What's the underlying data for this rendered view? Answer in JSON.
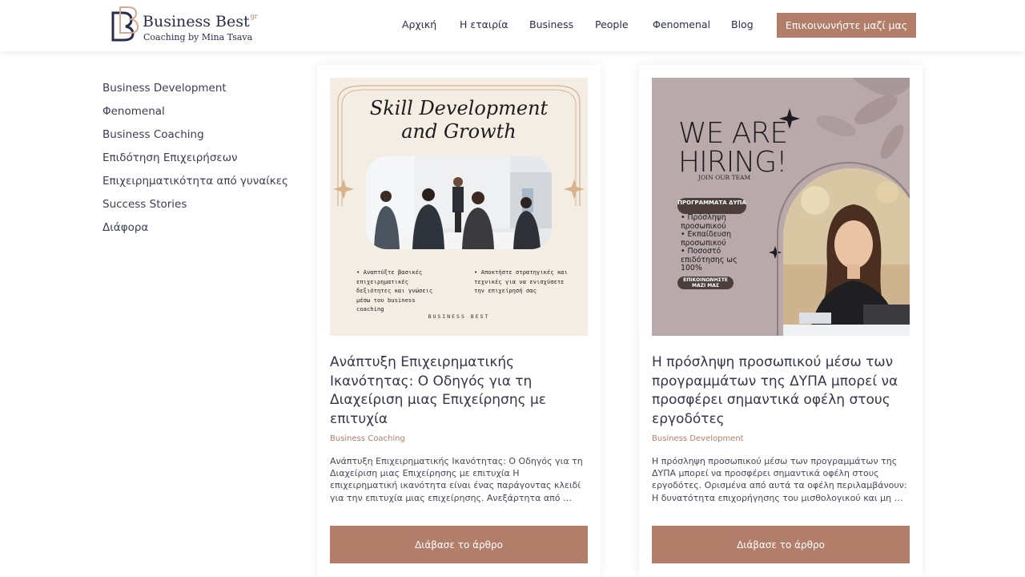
{
  "brand": {
    "name": "Business Best",
    "superscript": "gr",
    "tagline": "Coaching by Mina Tsava"
  },
  "nav": {
    "items": [
      {
        "label": "Αρχική"
      },
      {
        "label": "Η εταιρία"
      },
      {
        "label": "Business"
      },
      {
        "label": "People"
      },
      {
        "label": "Φenomenal"
      },
      {
        "label": "Blog"
      }
    ],
    "cta": "Επικοινωνήστε μαζί μας"
  },
  "sidebar": {
    "items": [
      {
        "label": "Business Development"
      },
      {
        "label": "Φenomenal"
      },
      {
        "label": "Business Coaching"
      },
      {
        "label": "Επιδότηση Επιχειρήσεων"
      },
      {
        "label": "Επιχειρηματικότητα από γυναίκες"
      },
      {
        "label": "Success Stories"
      },
      {
        "label": "Διάφορα"
      }
    ]
  },
  "posts": [
    {
      "title": "Ανάπτυξη Επιχειρηματικής Ικανότητας: Ο Οδηγός για τη Διαχείριση μιας Επιχείρησης με επιτυχία",
      "category": "Business Coaching",
      "excerpt": "Ανάπτυξη Επιχειρηματικής Ικανότητας: Ο Οδηγός για τη Διαχείριση μιας Επιχείρησης με επιτυχία Η επιχειρηματική ικανότητα είναι ένας παράγοντας κλειδί για την επιτυχία μιας επιχείρησης. Ανεξάρτητα από …",
      "button": "Διάβασε το άρθρο",
      "image": {
        "heading_line1": "Skill Development",
        "heading_line2": "and Growth",
        "bullet1": "• Αναπτύξτε βασικές επιχειρηματικές δεξιότητες και γνώσεις μέσω του business coaching",
        "bullet2": "• Αποκτήστε στρατηγικές και τεχνικές για να ενισχύσετε την επιχείρησή σας",
        "brand": "BUSINESS BEST"
      }
    },
    {
      "title": "Η πρόσληψη προσωπικού μέσω των προγραμμάτων της ΔΥΠΑ μπορεί να προσφέρει σημαντικά οφέλη στους εργοδότες",
      "category": "Business Development",
      "excerpt": "Η πρόσληψη προσωπικού μέσω των προγραμμάτων της ΔΥΠΑ μπορεί να προσφέρει σημαντικά οφέλη στους εργοδότες. Ορισμένα από αυτά τα οφέλη περιλαμβάνουν: Η δυνατότητα επιχορήγησης του μισθολογικού και μη …",
      "button": "Διάβασε το άρθρο",
      "image": {
        "heading_line1": "WE ARE",
        "heading_line2": "HIRING!",
        "join": "JOIN OUR TEAM",
        "pill_top": "ΠΡΟΓΡΑΜΜΑΤΑ ΔΥΠΑ",
        "list": [
          "• Πρόσληψη προσωπικού",
          "• Εκπαίδευση προσωπικού",
          "• Ποσοστό επιδότησης ως 100%"
        ],
        "pill_bottom": "ΕΠΙΚΟΙΝΩΝΗΣΤΕ ΜΑΖΙ ΜΑΣ"
      }
    }
  ],
  "colors": {
    "accent": "#b27e6a",
    "navy": "#2a2d4a",
    "card_image_bg_1": "#f4ede4",
    "card_image_bg_2": "#b9a9ab"
  }
}
